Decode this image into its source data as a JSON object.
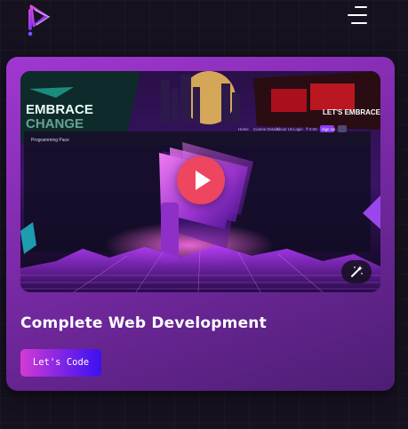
{
  "header": {
    "logo_icon": "brand-logo-icon",
    "menu_icon": "hamburger-menu-icon"
  },
  "card": {
    "title": "Complete Web Development",
    "button_label": "Let's Code",
    "video": {
      "play_icon": "play-icon",
      "magic_icon": "magic-wand-icon",
      "thumbnail": {
        "left_banner_text_line1": "EMBRACE",
        "left_banner_text_line2": "CHANGE",
        "right_banner_text": "LET'S EMBRACE",
        "site_brand": "Programming Pace",
        "site_nav": [
          "Home",
          "Course Details",
          "About Us",
          "Login",
          "₹ 0.00",
          "Sign Up"
        ]
      }
    }
  },
  "colors": {
    "page_background": "#16111f",
    "card_gradient_start": "#a137d2",
    "card_gradient_end": "#4c1e73",
    "play_button": "#ee4560",
    "button_gradient_start": "#d33bd3",
    "button_gradient_end": "#3b11f0"
  }
}
